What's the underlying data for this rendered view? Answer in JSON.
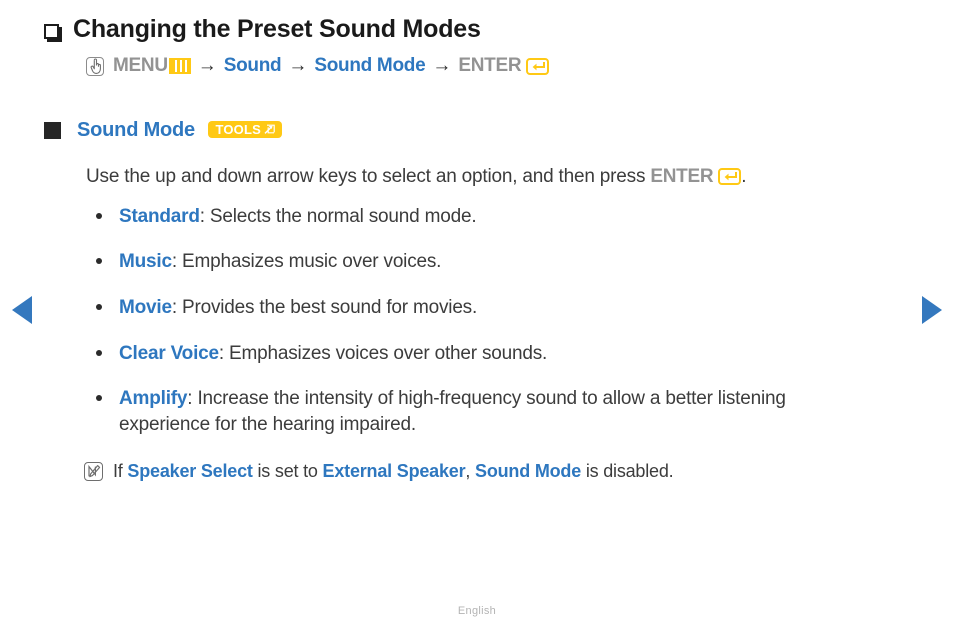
{
  "nav": {
    "prev_label": "previous-page",
    "next_label": "next-page"
  },
  "heading": {
    "text": "Changing the Preset Sound Modes",
    "bullet_icon": "square-outline-icon"
  },
  "menu_path": {
    "hand_icon": "hand-pointer-icon",
    "menu_label": "MENU",
    "menu_icon": "menu-bars-icon",
    "arrow1": "→",
    "step1": "Sound",
    "arrow2": "→",
    "step2": "Sound Mode",
    "arrow3": "→",
    "enter_label": "ENTER",
    "enter_icon": "enter-key-icon"
  },
  "section": {
    "bullet_icon": "square-solid-icon",
    "title": "Sound Mode",
    "badge_label": "TOOLS",
    "badge_icon": "tools-arrow-icon"
  },
  "body": {
    "before_enter": "Use the up and down arrow keys to select an option, and then press ",
    "enter_label": "ENTER",
    "enter_icon": "enter-key-icon",
    "after_enter": "."
  },
  "bullets": [
    {
      "term": "Standard",
      "desc": ": Selects the normal sound mode."
    },
    {
      "term": "Music",
      "desc": ": Emphasizes music over voices."
    },
    {
      "term": "Movie",
      "desc": ": Provides the best sound for movies."
    },
    {
      "term": "Clear Voice",
      "desc": ": Emphasizes voices over other sounds."
    },
    {
      "term": "Amplify",
      "desc": ": Increase the intensity of high-frequency sound to allow a better listening experience for the hearing impaired."
    }
  ],
  "note": {
    "icon": "note-n-icon",
    "part1": "If ",
    "term1": "Speaker Select",
    "part2": " is set to ",
    "term2": "External Speaker",
    "part3": ", ",
    "term3": "Sound Mode",
    "part4": " is disabled."
  },
  "footer": {
    "language": "English"
  },
  "colors": {
    "accent_blue": "#2e77bf",
    "accent_yellow": "#ffc915",
    "gray_text": "#939393",
    "body_text": "#3c3c3c",
    "nav_blue": "#3478be"
  }
}
